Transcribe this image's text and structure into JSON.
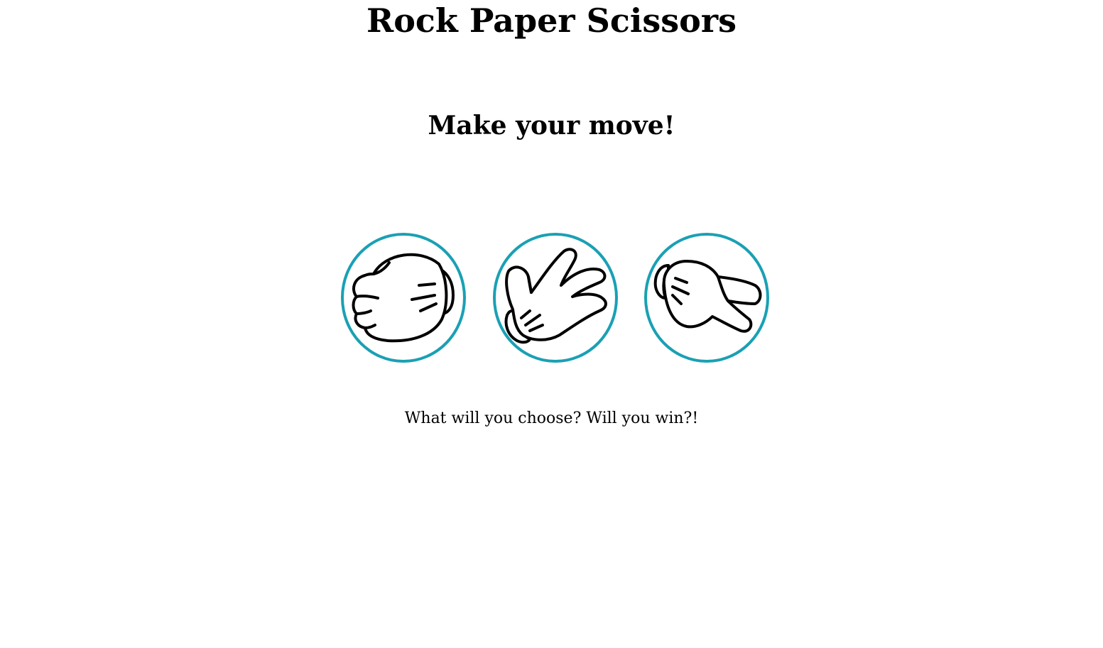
{
  "title": "Rock Paper Scissors",
  "prompt": "Make your move!",
  "choices": [
    {
      "id": "rock",
      "icon": "rock-hand-icon"
    },
    {
      "id": "paper",
      "icon": "paper-hand-icon"
    },
    {
      "id": "scissors",
      "icon": "scissors-hand-icon"
    }
  ],
  "message": "What will you choose? Will you win?!",
  "colors": {
    "accent": "#1aa0b4",
    "background": "#ffffff",
    "text": "#000000"
  }
}
